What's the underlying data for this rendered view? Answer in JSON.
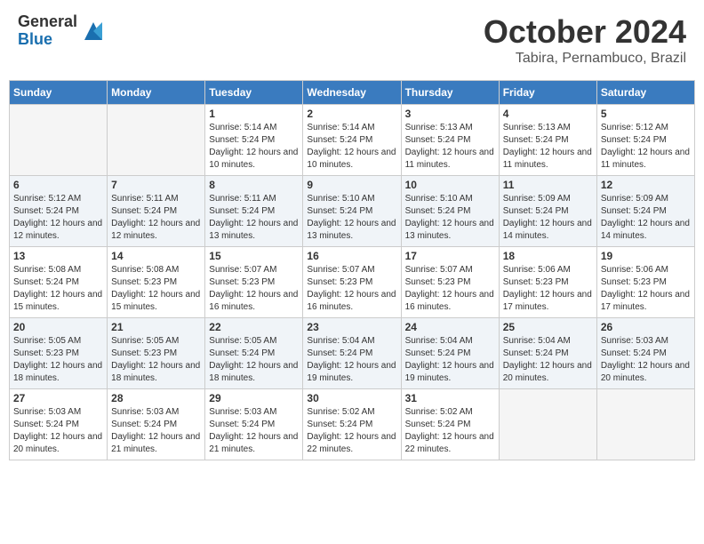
{
  "header": {
    "logo_general": "General",
    "logo_blue": "Blue",
    "month_title": "October 2024",
    "subtitle": "Tabira, Pernambuco, Brazil"
  },
  "days_of_week": [
    "Sunday",
    "Monday",
    "Tuesday",
    "Wednesday",
    "Thursday",
    "Friday",
    "Saturday"
  ],
  "weeks": [
    [
      {
        "day": "",
        "info": ""
      },
      {
        "day": "",
        "info": ""
      },
      {
        "day": "1",
        "sunrise": "5:14 AM",
        "sunset": "5:24 PM",
        "daylight": "12 hours and 10 minutes."
      },
      {
        "day": "2",
        "sunrise": "5:14 AM",
        "sunset": "5:24 PM",
        "daylight": "12 hours and 10 minutes."
      },
      {
        "day": "3",
        "sunrise": "5:13 AM",
        "sunset": "5:24 PM",
        "daylight": "12 hours and 11 minutes."
      },
      {
        "day": "4",
        "sunrise": "5:13 AM",
        "sunset": "5:24 PM",
        "daylight": "12 hours and 11 minutes."
      },
      {
        "day": "5",
        "sunrise": "5:12 AM",
        "sunset": "5:24 PM",
        "daylight": "12 hours and 11 minutes."
      }
    ],
    [
      {
        "day": "6",
        "sunrise": "5:12 AM",
        "sunset": "5:24 PM",
        "daylight": "12 hours and 12 minutes."
      },
      {
        "day": "7",
        "sunrise": "5:11 AM",
        "sunset": "5:24 PM",
        "daylight": "12 hours and 12 minutes."
      },
      {
        "day": "8",
        "sunrise": "5:11 AM",
        "sunset": "5:24 PM",
        "daylight": "12 hours and 13 minutes."
      },
      {
        "day": "9",
        "sunrise": "5:10 AM",
        "sunset": "5:24 PM",
        "daylight": "12 hours and 13 minutes."
      },
      {
        "day": "10",
        "sunrise": "5:10 AM",
        "sunset": "5:24 PM",
        "daylight": "12 hours and 13 minutes."
      },
      {
        "day": "11",
        "sunrise": "5:09 AM",
        "sunset": "5:24 PM",
        "daylight": "12 hours and 14 minutes."
      },
      {
        "day": "12",
        "sunrise": "5:09 AM",
        "sunset": "5:24 PM",
        "daylight": "12 hours and 14 minutes."
      }
    ],
    [
      {
        "day": "13",
        "sunrise": "5:08 AM",
        "sunset": "5:24 PM",
        "daylight": "12 hours and 15 minutes."
      },
      {
        "day": "14",
        "sunrise": "5:08 AM",
        "sunset": "5:23 PM",
        "daylight": "12 hours and 15 minutes."
      },
      {
        "day": "15",
        "sunrise": "5:07 AM",
        "sunset": "5:23 PM",
        "daylight": "12 hours and 16 minutes."
      },
      {
        "day": "16",
        "sunrise": "5:07 AM",
        "sunset": "5:23 PM",
        "daylight": "12 hours and 16 minutes."
      },
      {
        "day": "17",
        "sunrise": "5:07 AM",
        "sunset": "5:23 PM",
        "daylight": "12 hours and 16 minutes."
      },
      {
        "day": "18",
        "sunrise": "5:06 AM",
        "sunset": "5:23 PM",
        "daylight": "12 hours and 17 minutes."
      },
      {
        "day": "19",
        "sunrise": "5:06 AM",
        "sunset": "5:23 PM",
        "daylight": "12 hours and 17 minutes."
      }
    ],
    [
      {
        "day": "20",
        "sunrise": "5:05 AM",
        "sunset": "5:23 PM",
        "daylight": "12 hours and 18 minutes."
      },
      {
        "day": "21",
        "sunrise": "5:05 AM",
        "sunset": "5:23 PM",
        "daylight": "12 hours and 18 minutes."
      },
      {
        "day": "22",
        "sunrise": "5:05 AM",
        "sunset": "5:24 PM",
        "daylight": "12 hours and 18 minutes."
      },
      {
        "day": "23",
        "sunrise": "5:04 AM",
        "sunset": "5:24 PM",
        "daylight": "12 hours and 19 minutes."
      },
      {
        "day": "24",
        "sunrise": "5:04 AM",
        "sunset": "5:24 PM",
        "daylight": "12 hours and 19 minutes."
      },
      {
        "day": "25",
        "sunrise": "5:04 AM",
        "sunset": "5:24 PM",
        "daylight": "12 hours and 20 minutes."
      },
      {
        "day": "26",
        "sunrise": "5:03 AM",
        "sunset": "5:24 PM",
        "daylight": "12 hours and 20 minutes."
      }
    ],
    [
      {
        "day": "27",
        "sunrise": "5:03 AM",
        "sunset": "5:24 PM",
        "daylight": "12 hours and 20 minutes."
      },
      {
        "day": "28",
        "sunrise": "5:03 AM",
        "sunset": "5:24 PM",
        "daylight": "12 hours and 21 minutes."
      },
      {
        "day": "29",
        "sunrise": "5:03 AM",
        "sunset": "5:24 PM",
        "daylight": "12 hours and 21 minutes."
      },
      {
        "day": "30",
        "sunrise": "5:02 AM",
        "sunset": "5:24 PM",
        "daylight": "12 hours and 22 minutes."
      },
      {
        "day": "31",
        "sunrise": "5:02 AM",
        "sunset": "5:24 PM",
        "daylight": "12 hours and 22 minutes."
      },
      {
        "day": "",
        "info": ""
      },
      {
        "day": "",
        "info": ""
      }
    ]
  ]
}
